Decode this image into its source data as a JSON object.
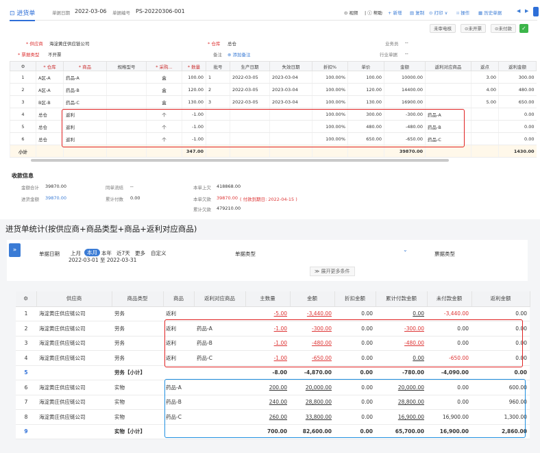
{
  "top": {
    "tab_title": "进货单",
    "date_label": "单据日期",
    "date_value": "2022-03-06",
    "no_label": "单据编号",
    "no_value": "PS-20220306-001",
    "actions": [
      "⊙ 视频",
      "| ⓘ 帮助",
      "+ 新增",
      "复制",
      "⊙ 打印 ∨",
      "操作",
      "历史单据"
    ],
    "status_buttons": [
      "未审电核",
      "⊙未开票",
      "⊙未付款"
    ],
    "supplier_label": "* 供应商",
    "supplier_value": "海淀黄庄供应链公司",
    "warehouse_label": "* 仓库",
    "warehouse_value": "总仓",
    "clerk_label": "业务员",
    "clerk_value": "--",
    "billtype_label": "* 票据类型",
    "billtype_value": "不开票",
    "remark_label": "备注",
    "remark_value": "添加备注",
    "industry_label": "行业单据",
    "industry_value": "--",
    "headers": [
      "⚙",
      "* 仓库",
      "* 商品",
      "规格型号",
      "* 采购...",
      "* 数量",
      "批号",
      "生产日期",
      "失效日期",
      "折扣%",
      "单价",
      "金额",
      "返利对应商品",
      "返点",
      "返利金额"
    ],
    "rows": [
      [
        "1",
        "A区-A",
        "药品-A",
        "",
        "盒",
        "100.00",
        "1",
        "2022-03-05",
        "2023-03-04",
        "100.00%",
        "100.00",
        "10000.00",
        "",
        "3.00",
        "300.00"
      ],
      [
        "2",
        "A区-A",
        "药品-B",
        "",
        "盒",
        "120.00",
        "2",
        "2022-03-05",
        "2023-03-04",
        "100.00%",
        "120.00",
        "14400.00",
        "",
        "4.00",
        "480.00"
      ],
      [
        "3",
        "B区-B",
        "药品-C",
        "",
        "盒",
        "130.00",
        "3",
        "2022-03-05",
        "2023-03-04",
        "100.00%",
        "130.00",
        "16900.00",
        "",
        "5.00",
        "650.00"
      ],
      [
        "4",
        "总仓",
        "返利",
        "",
        "个",
        "-1.00",
        "",
        "",
        "",
        "100.00%",
        "300.00",
        "-300.00",
        "药品-A",
        "",
        "0.00"
      ],
      [
        "5",
        "总仓",
        "返利",
        "",
        "个",
        "-1.00",
        "",
        "",
        "",
        "100.00%",
        "480.00",
        "-480.00",
        "药品-B",
        "",
        "0.00"
      ],
      [
        "6",
        "总仓",
        "返利",
        "",
        "个",
        "-1.00",
        "",
        "",
        "",
        "100.00%",
        "650.00",
        "-650.00",
        "药品-C",
        "",
        "0.00"
      ]
    ],
    "subtotal": [
      "小计",
      "",
      "",
      "",
      "",
      "347.00",
      "",
      "",
      "",
      "",
      "",
      "39870.00",
      "",
      "",
      "1430.00"
    ],
    "pay_title": "收款信息",
    "pay": {
      "total_label": "金额合计",
      "total_value": "39870.00",
      "purchase_label": "进货金额",
      "purchase_value": "39870.00",
      "sync_label": "同单流结",
      "sync_value": "--",
      "paid_label": "累计付数",
      "paid_value": "0.00",
      "prev_label": "本单上欠",
      "prev_value": "418868.00",
      "cur_label": "本单欠款",
      "cur_value": "39870.00",
      "cur_note": "( 付款到期日: 2022-04-15 )",
      "acc_label": "累计欠款",
      "acc_value": "479210.00"
    }
  },
  "bottom": {
    "title": "进货单统计(按供应商+商品类型+商品+返利对应商品)",
    "date_label": "单据日期",
    "date_opts": [
      "上月",
      "本月",
      "本年",
      "近7天",
      "更多",
      "自定义"
    ],
    "date_range": "2022-03-01 至 2022-03-31",
    "billtype_label": "单据类型",
    "ticket_label": "票据类型",
    "expand": "≫ 展开更多条件",
    "headers": [
      "⚙",
      "供应商",
      "商品类型",
      "商品",
      "返利对应商品",
      "主数量",
      "金额",
      "折扣金额",
      "累计付款金额",
      "未付款金额",
      "返利金额"
    ],
    "rows": [
      [
        "1",
        "海淀黄庄供应链公司",
        "劳务",
        "返利",
        "",
        "-5.00",
        "-3,440.00",
        "0.00",
        "0.00",
        "-3,440.00",
        "0.00"
      ],
      [
        "2",
        "海淀黄庄供应链公司",
        "劳务",
        "返利",
        "药品-A",
        "-1.00",
        "-300.00",
        "0.00",
        "-300.00",
        "0.00",
        "0.00"
      ],
      [
        "3",
        "海淀黄庄供应链公司",
        "劳务",
        "返利",
        "药品-B",
        "-1.00",
        "-480.00",
        "0.00",
        "-480.00",
        "0.00",
        "0.00"
      ],
      [
        "4",
        "海淀黄庄供应链公司",
        "劳务",
        "返利",
        "药品-C",
        "-1.00",
        "-650.00",
        "0.00",
        "0.00",
        "-650.00",
        "0.00"
      ],
      [
        "5",
        "",
        "劳务【小计】",
        "",
        "",
        "-8.00",
        "-4,870.00",
        "0.00",
        "-780.00",
        "-4,090.00",
        "0.00"
      ],
      [
        "6",
        "海淀黄庄供应链公司",
        "实物",
        "药品-A",
        "",
        "200.00",
        "20,000.00",
        "0.00",
        "20,000.00",
        "0.00",
        "600.00"
      ],
      [
        "7",
        "海淀黄庄供应链公司",
        "实物",
        "药品-B",
        "",
        "240.00",
        "28,800.00",
        "0.00",
        "28,800.00",
        "0.00",
        "960.00"
      ],
      [
        "8",
        "海淀黄庄供应链公司",
        "实物",
        "药品-C",
        "",
        "260.00",
        "33,800.00",
        "0.00",
        "16,900.00",
        "16,900.00",
        "1,300.00"
      ],
      [
        "9",
        "",
        "实物【小计】",
        "",
        "",
        "700.00",
        "82,600.00",
        "0.00",
        "65,700.00",
        "16,900.00",
        "2,860.00"
      ]
    ]
  }
}
